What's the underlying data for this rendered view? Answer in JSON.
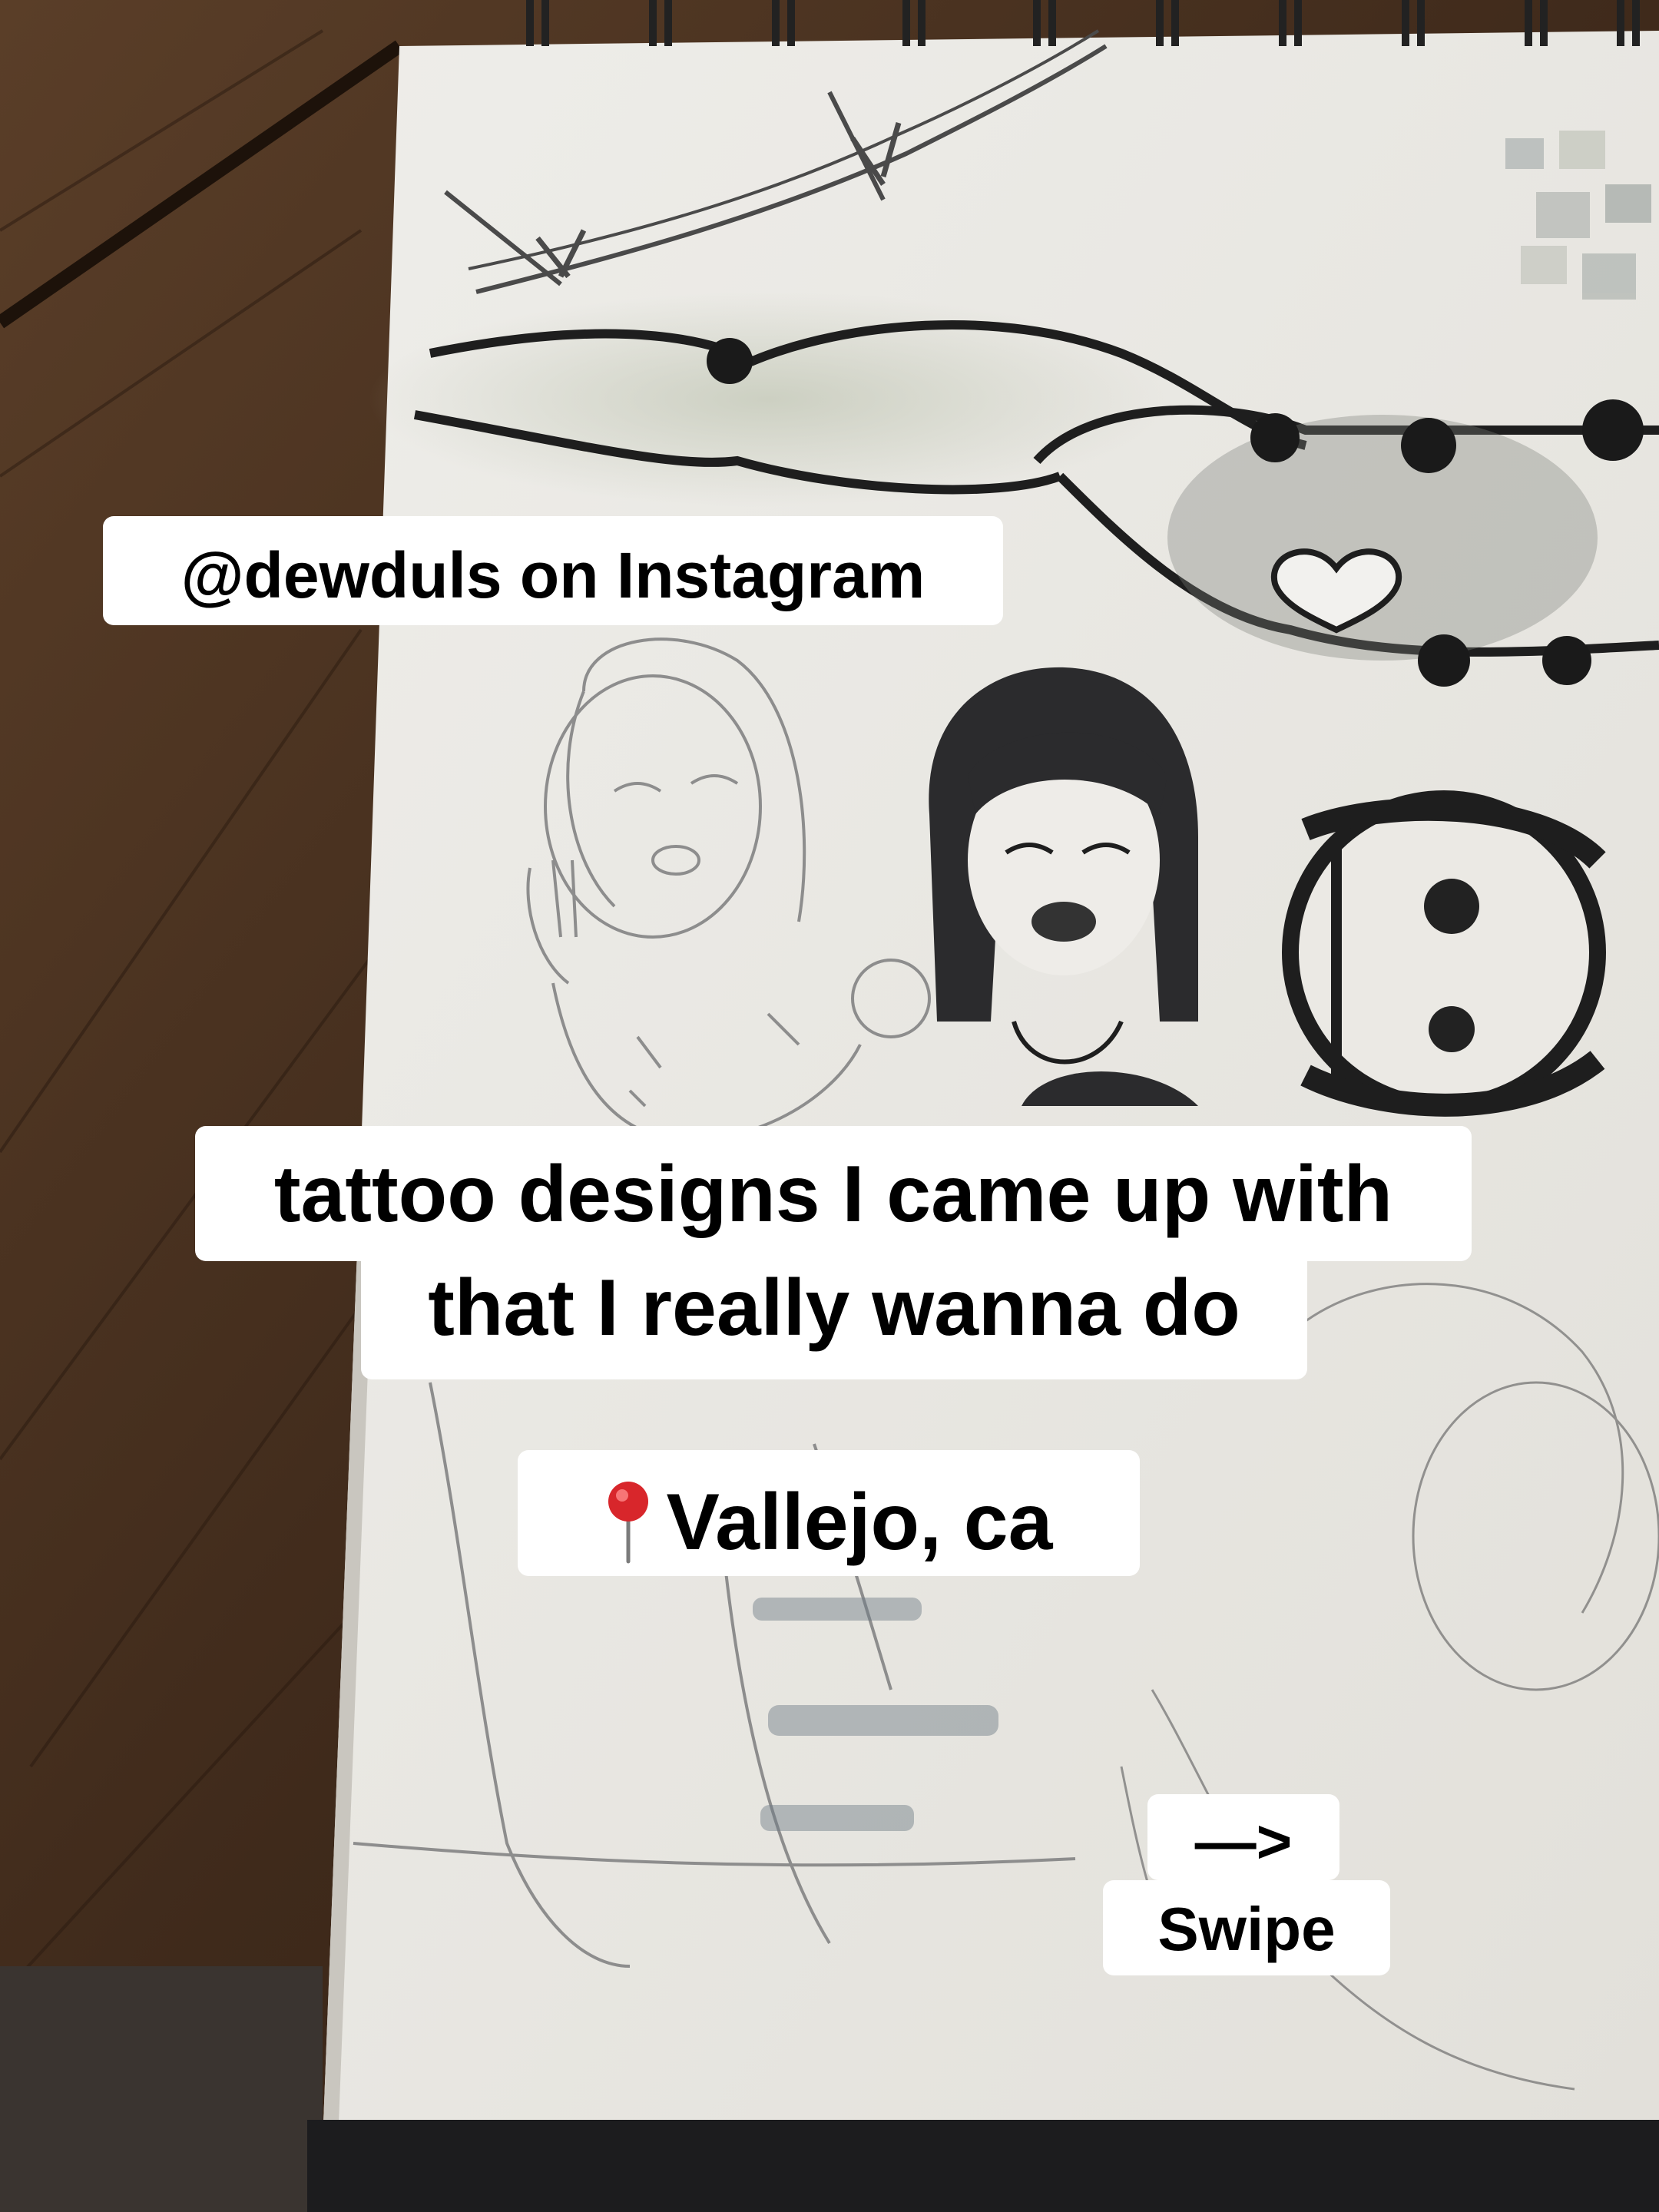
{
  "overlay": {
    "handle": "@dewduls on Instagram",
    "title_line_1": "tattoo designs I came up with",
    "title_line_2": "that I really wanna do",
    "location_pin_icon": "round-pushpin-emoji",
    "location": "Vallejo, ca",
    "swipe_arrow": "—>",
    "swipe_label": "Swipe"
  },
  "colors": {
    "table_wood": "#4a3322",
    "paper": "#e9e7e2",
    "ink": "#1e1e1e",
    "caption_bg": "#ffffff",
    "pin_red": "#d8262b"
  }
}
